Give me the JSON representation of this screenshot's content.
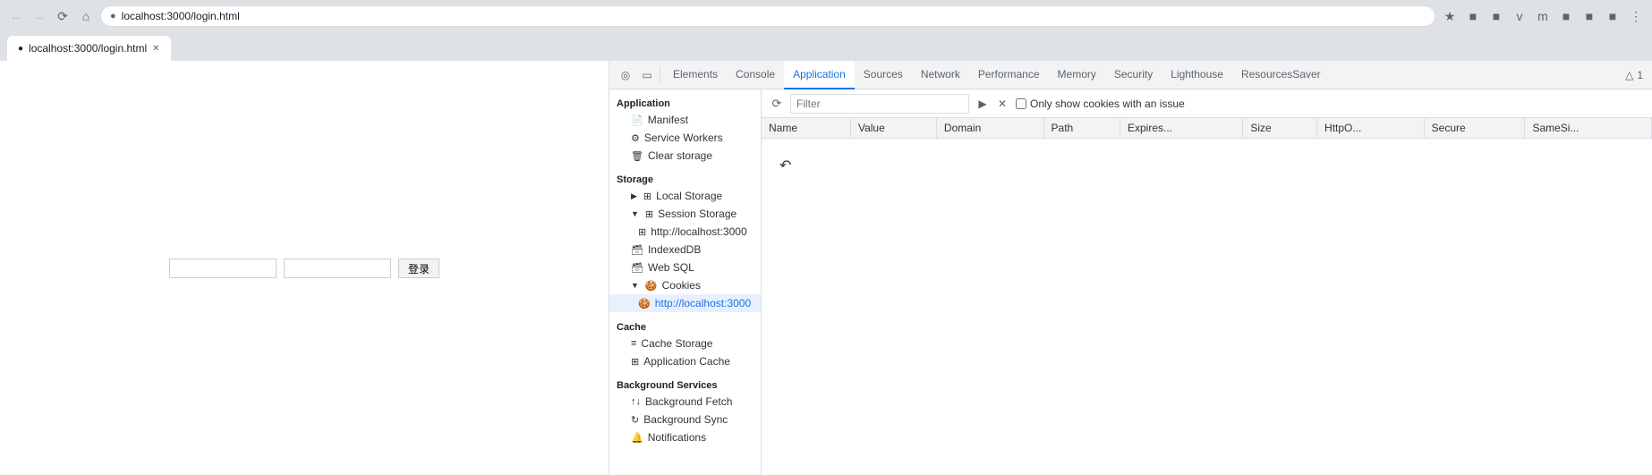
{
  "browser": {
    "url": "localhost:3000/login.html",
    "back_disabled": true,
    "forward_disabled": true,
    "tab_title": "localhost:3000/login.html"
  },
  "login_form": {
    "input1_placeholder": "",
    "input2_placeholder": "",
    "button_label": "登录"
  },
  "devtools": {
    "tabs": [
      {
        "label": "Elements",
        "active": false
      },
      {
        "label": "Console",
        "active": false
      },
      {
        "label": "Application",
        "active": true
      },
      {
        "label": "Sources",
        "active": false
      },
      {
        "label": "Network",
        "active": false
      },
      {
        "label": "Performance",
        "active": false
      },
      {
        "label": "Memory",
        "active": false
      },
      {
        "label": "Security",
        "active": false
      },
      {
        "label": "Lighthouse",
        "active": false
      },
      {
        "label": "ResourcesSaver",
        "active": false
      }
    ],
    "panel_icons": [
      "inspect",
      "device"
    ],
    "overflow_label": "▲ 1",
    "sidebar": {
      "sections": [
        {
          "header": "Application",
          "items": [
            {
              "label": "Manifest",
              "icon": "📄",
              "indent": 1,
              "active": false,
              "expand": ""
            },
            {
              "label": "Service Workers",
              "icon": "⚙",
              "indent": 1,
              "active": false,
              "expand": ""
            },
            {
              "label": "Clear storage",
              "icon": "🗑",
              "indent": 1,
              "active": false,
              "expand": ""
            }
          ]
        },
        {
          "header": "Storage",
          "items": [
            {
              "label": "Local Storage",
              "icon": "⊞",
              "indent": 1,
              "active": false,
              "expand": "▶"
            },
            {
              "label": "Session Storage",
              "icon": "⊞",
              "indent": 1,
              "active": false,
              "expand": "▼"
            },
            {
              "label": "http://localhost:3000",
              "icon": "⊞",
              "indent": 2,
              "active": false,
              "expand": ""
            },
            {
              "label": "IndexedDB",
              "icon": "🗃",
              "indent": 1,
              "active": false,
              "expand": ""
            },
            {
              "label": "Web SQL",
              "icon": "🗃",
              "indent": 1,
              "active": false,
              "expand": ""
            },
            {
              "label": "Cookies",
              "icon": "🍪",
              "indent": 1,
              "active": false,
              "expand": "▼"
            },
            {
              "label": "http://localhost:3000",
              "icon": "🍪",
              "indent": 2,
              "active": true,
              "expand": ""
            }
          ]
        },
        {
          "header": "Cache",
          "items": [
            {
              "label": "Cache Storage",
              "icon": "≡",
              "indent": 1,
              "active": false,
              "expand": ""
            },
            {
              "label": "Application Cache",
              "icon": "⊞",
              "indent": 1,
              "active": false,
              "expand": ""
            }
          ]
        },
        {
          "header": "Background Services",
          "items": [
            {
              "label": "Background Fetch",
              "icon": "↑↓",
              "indent": 1,
              "active": false,
              "expand": ""
            },
            {
              "label": "Background Sync",
              "icon": "↻",
              "indent": 1,
              "active": false,
              "expand": ""
            },
            {
              "label": "Notifications",
              "icon": "🔔",
              "indent": 1,
              "active": false,
              "expand": ""
            }
          ]
        }
      ]
    },
    "cookies_toolbar": {
      "filter_placeholder": "Filter",
      "show_cookies_label": "Only show cookies with an issue"
    },
    "table": {
      "columns": [
        "Name",
        "Value",
        "Domain",
        "Path",
        "Expires...",
        "Size",
        "HttpO...",
        "Secure",
        "SameSi..."
      ],
      "rows": []
    }
  }
}
